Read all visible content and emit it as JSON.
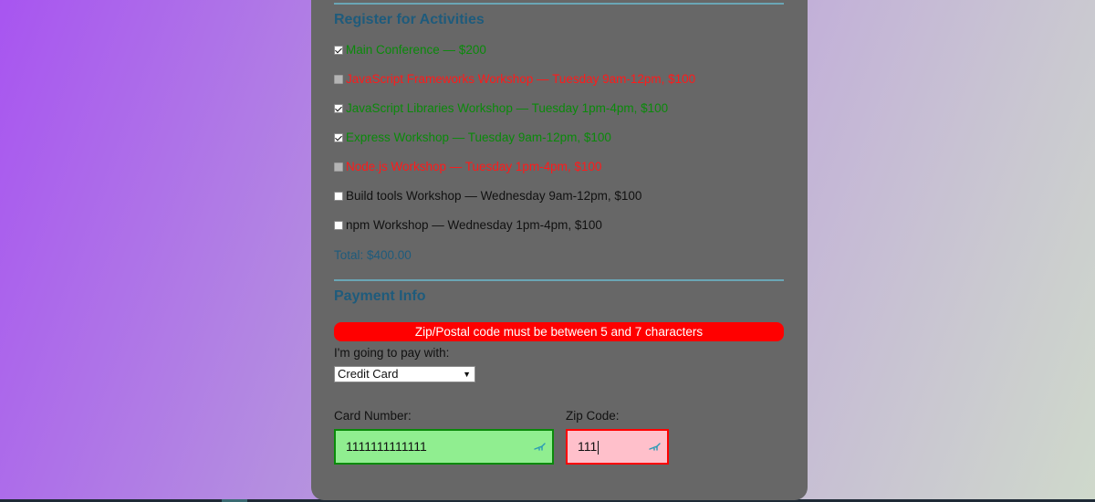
{
  "activities": {
    "title": "Register for Activities",
    "items": [
      {
        "label": "Main Conference — $200",
        "checked": true,
        "state": "selected"
      },
      {
        "label": "JavaScript Frameworks Workshop — Tuesday 9am-12pm, $100",
        "checked": false,
        "state": "conflict"
      },
      {
        "label": "JavaScript Libraries Workshop — Tuesday 1pm-4pm, $100",
        "checked": true,
        "state": "selected"
      },
      {
        "label": "Express Workshop — Tuesday 9am-12pm, $100",
        "checked": true,
        "state": "selected"
      },
      {
        "label": "Node.js Workshop — Tuesday 1pm-4pm, $100",
        "checked": false,
        "state": "conflict"
      },
      {
        "label": "Build tools Workshop — Wednesday 9am-12pm, $100",
        "checked": false,
        "state": "available"
      },
      {
        "label": "npm Workshop — Wednesday 1pm-4pm, $100",
        "checked": false,
        "state": "available"
      }
    ],
    "total": "Total: $400.00"
  },
  "payment": {
    "title": "Payment Info",
    "error": "Zip/Postal code must be between 5 and 7 characters",
    "pay_with_label": "I'm going to pay with:",
    "method_selected": "Credit Card",
    "card_number_label": "Card Number:",
    "card_number_value": "1111111111111",
    "zip_label": "Zip Code:",
    "zip_value": "111"
  },
  "colors": {
    "panel": "#676767",
    "heading": "#1e5b7c",
    "valid": "#0a8a0a",
    "invalid": "#ff0000"
  }
}
